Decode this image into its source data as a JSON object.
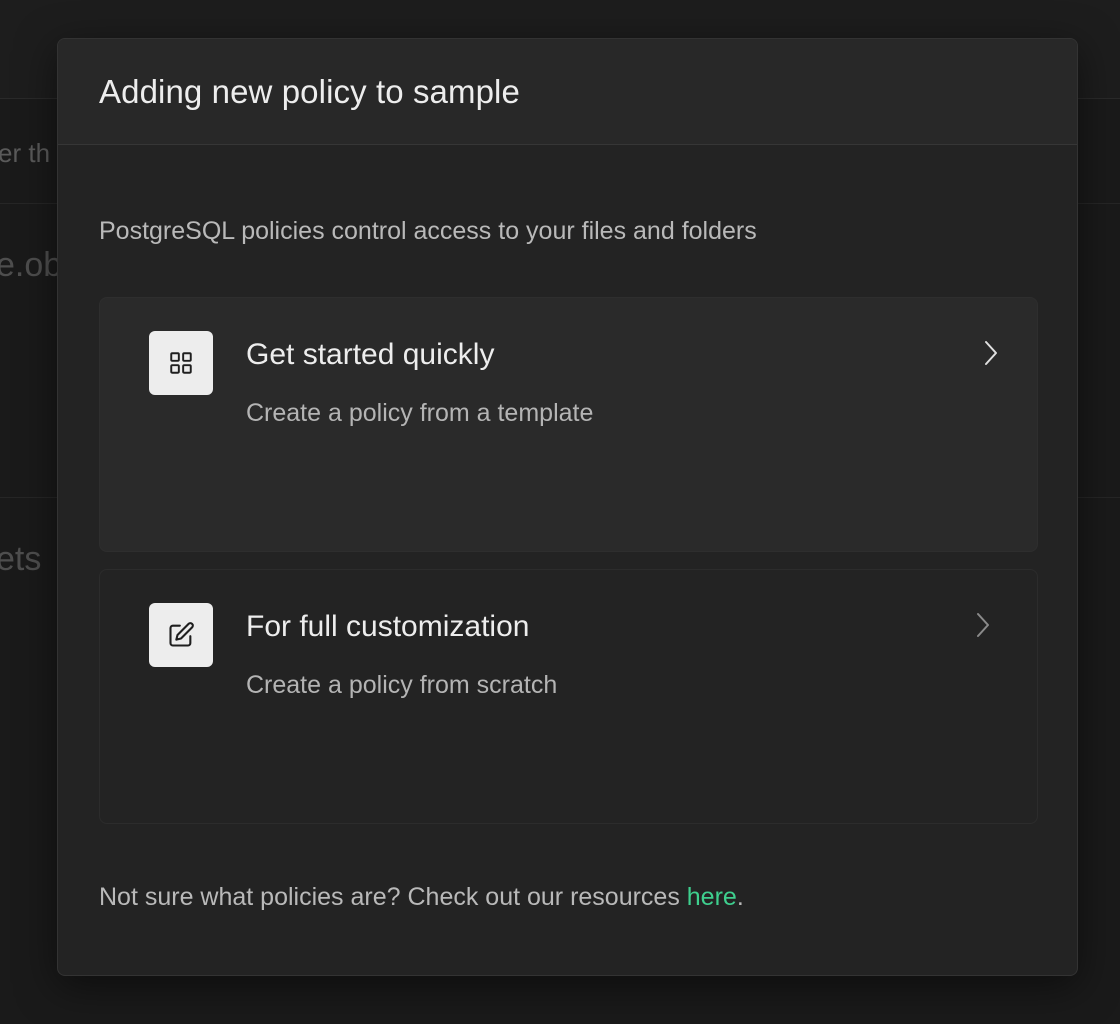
{
  "background": {
    "row1_text": "er th",
    "row2_text": "e.ob",
    "row3_text": "ets"
  },
  "modal": {
    "title": "Adding new policy to sample",
    "description": "PostgreSQL policies control access to your files and folders",
    "options": [
      {
        "title": "Get started quickly",
        "subtitle": "Create a policy from a template",
        "icon": "grid-icon"
      },
      {
        "title": "For full customization",
        "subtitle": "Create a policy from scratch",
        "icon": "edit-icon"
      }
    ],
    "footer": {
      "prefix": "Not sure what policies are? Check out our resources ",
      "link_label": "here",
      "suffix": "."
    }
  },
  "colors": {
    "accent": "#3ecf8e",
    "modal_bg": "#232323",
    "card_highlight_bg": "#2a2a2a",
    "icon_box_bg": "#ededed"
  }
}
